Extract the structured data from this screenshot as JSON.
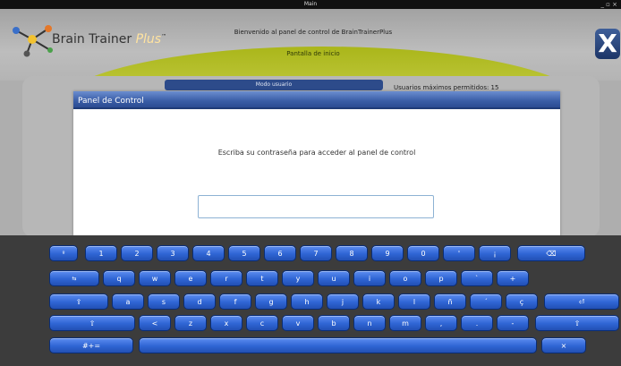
{
  "window": {
    "title": "Main",
    "controls": "_ ▫ ×"
  },
  "header": {
    "logo_main": "Brain Trainer",
    "logo_plus": "Plus",
    "logo_tm": "™",
    "welcome": "Bienvenido al panel de control de BrainTrainerPlus",
    "subtitle": "Pantalla de inicio",
    "close_icon": "X"
  },
  "background": {
    "blue_button_label": "Modo usuario",
    "max_users": "Usuarios máximos permitidos: 15"
  },
  "dialog": {
    "title": "Panel de Control",
    "message": "Escriba su contraseña para acceder al panel de control",
    "password_value": ""
  },
  "keyboard": {
    "rows": [
      [
        "º",
        "1",
        "2",
        "3",
        "4",
        "5",
        "6",
        "7",
        "8",
        "9",
        "0",
        "'",
        "¡",
        "⌫"
      ],
      [
        "⇆",
        "q",
        "w",
        "e",
        "r",
        "t",
        "y",
        "u",
        "i",
        "o",
        "p",
        "`",
        "+"
      ],
      [
        "⇪",
        "a",
        "s",
        "d",
        "f",
        "g",
        "h",
        "j",
        "k",
        "l",
        "ñ",
        "´",
        "ç",
        "⏎"
      ],
      [
        "⇧",
        "<",
        "z",
        "x",
        "c",
        "v",
        "b",
        "n",
        "m",
        ",",
        ".",
        "-",
        "⇧"
      ],
      [
        "#+=",
        "",
        "×"
      ]
    ]
  },
  "colors": {
    "key": "#2f65d4",
    "dialog_title": "#3a5da6",
    "olive": "#b8c230"
  }
}
